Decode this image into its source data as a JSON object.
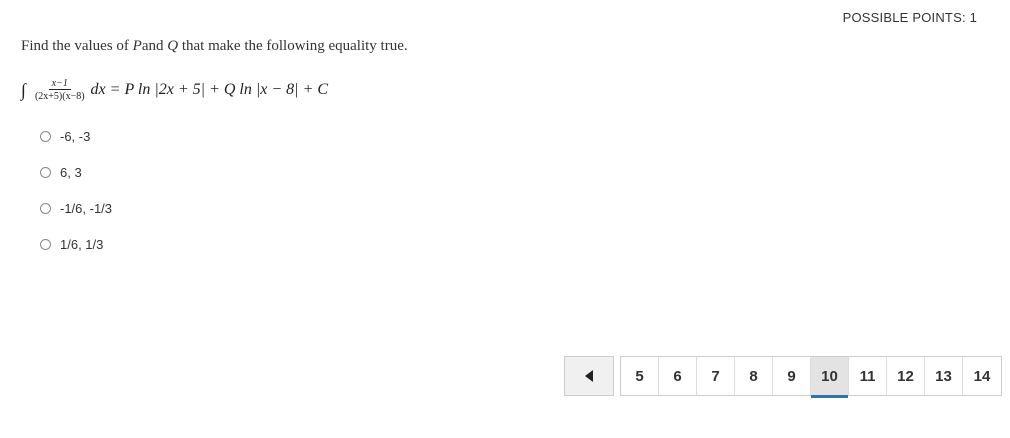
{
  "header": {
    "possible_points": "POSSIBLE POINTS: 1"
  },
  "question": {
    "prefix": "Find the values of ",
    "var_p": "P",
    "mid": "and ",
    "var_q": "Q",
    "suffix": " that make the following equality true."
  },
  "equation": {
    "integral": "∫",
    "numerator": "x−1",
    "denominator": "(2x+5)(x−8)",
    "rhs": "dx = P ln |2x + 5| + Q ln |x − 8| + C"
  },
  "options": [
    {
      "label": "-6, -3"
    },
    {
      "label": "6, 3"
    },
    {
      "label": "-1/6, -1/3"
    },
    {
      "label": "1/6, 1/3"
    }
  ],
  "pagination": {
    "pages": [
      "5",
      "6",
      "7",
      "8",
      "9",
      "10",
      "11",
      "12",
      "13",
      "14"
    ],
    "active": "10",
    "accent_color": "#2e73ad"
  }
}
